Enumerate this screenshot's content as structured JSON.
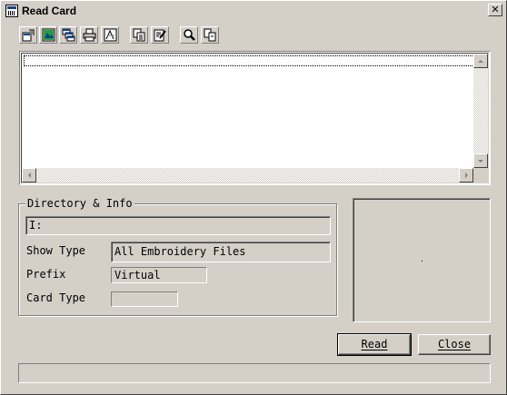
{
  "window": {
    "title": "Read Card",
    "close_glyph": "✕"
  },
  "toolbar": {
    "buttons": [
      {
        "name": "properties-icon"
      },
      {
        "name": "image-icon"
      },
      {
        "name": "cascade-icon"
      },
      {
        "name": "print-icon"
      },
      {
        "name": "design-icon"
      },
      {
        "name": "copy-icon"
      },
      {
        "name": "edit-icon"
      },
      {
        "name": "search-icon"
      },
      {
        "name": "transfer-icon"
      }
    ]
  },
  "info": {
    "group_title": "Directory & Info",
    "directory_value": "I:",
    "show_type_label": "Show Type",
    "show_type_value": "All Embroidery Files",
    "prefix_label": "Prefix",
    "prefix_value": "Virtual",
    "card_type_label": "Card Type",
    "card_type_value": ""
  },
  "buttons": {
    "read_label": "Read",
    "close_label": "Close"
  },
  "status": {
    "text": ""
  }
}
